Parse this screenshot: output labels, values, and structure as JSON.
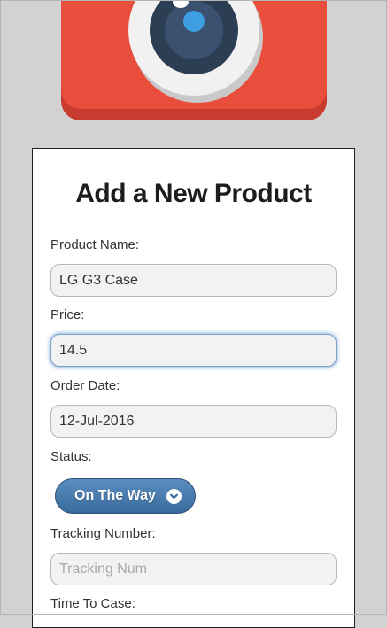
{
  "form": {
    "title": "Add a New Product",
    "product_name": {
      "label": "Product Name:",
      "value": "LG G3 Case"
    },
    "price": {
      "label": "Price:",
      "value": "14.5"
    },
    "order_date": {
      "label": "Order Date:",
      "value": "12-Jul-2016"
    },
    "status": {
      "label": "Status:",
      "selected": "On The Way"
    },
    "tracking_number": {
      "label": "Tracking Number:",
      "value": "",
      "placeholder": "Tracking Num"
    },
    "time_to_case": {
      "label": "Time To Case:"
    }
  },
  "icons": {
    "logo": "camera-icon",
    "status_dropdown": "chevron-down-icon"
  },
  "colors": {
    "logo_red": "#e94e3c",
    "button_blue": "#4a7eb0",
    "focus_glow": "#6496d2"
  }
}
